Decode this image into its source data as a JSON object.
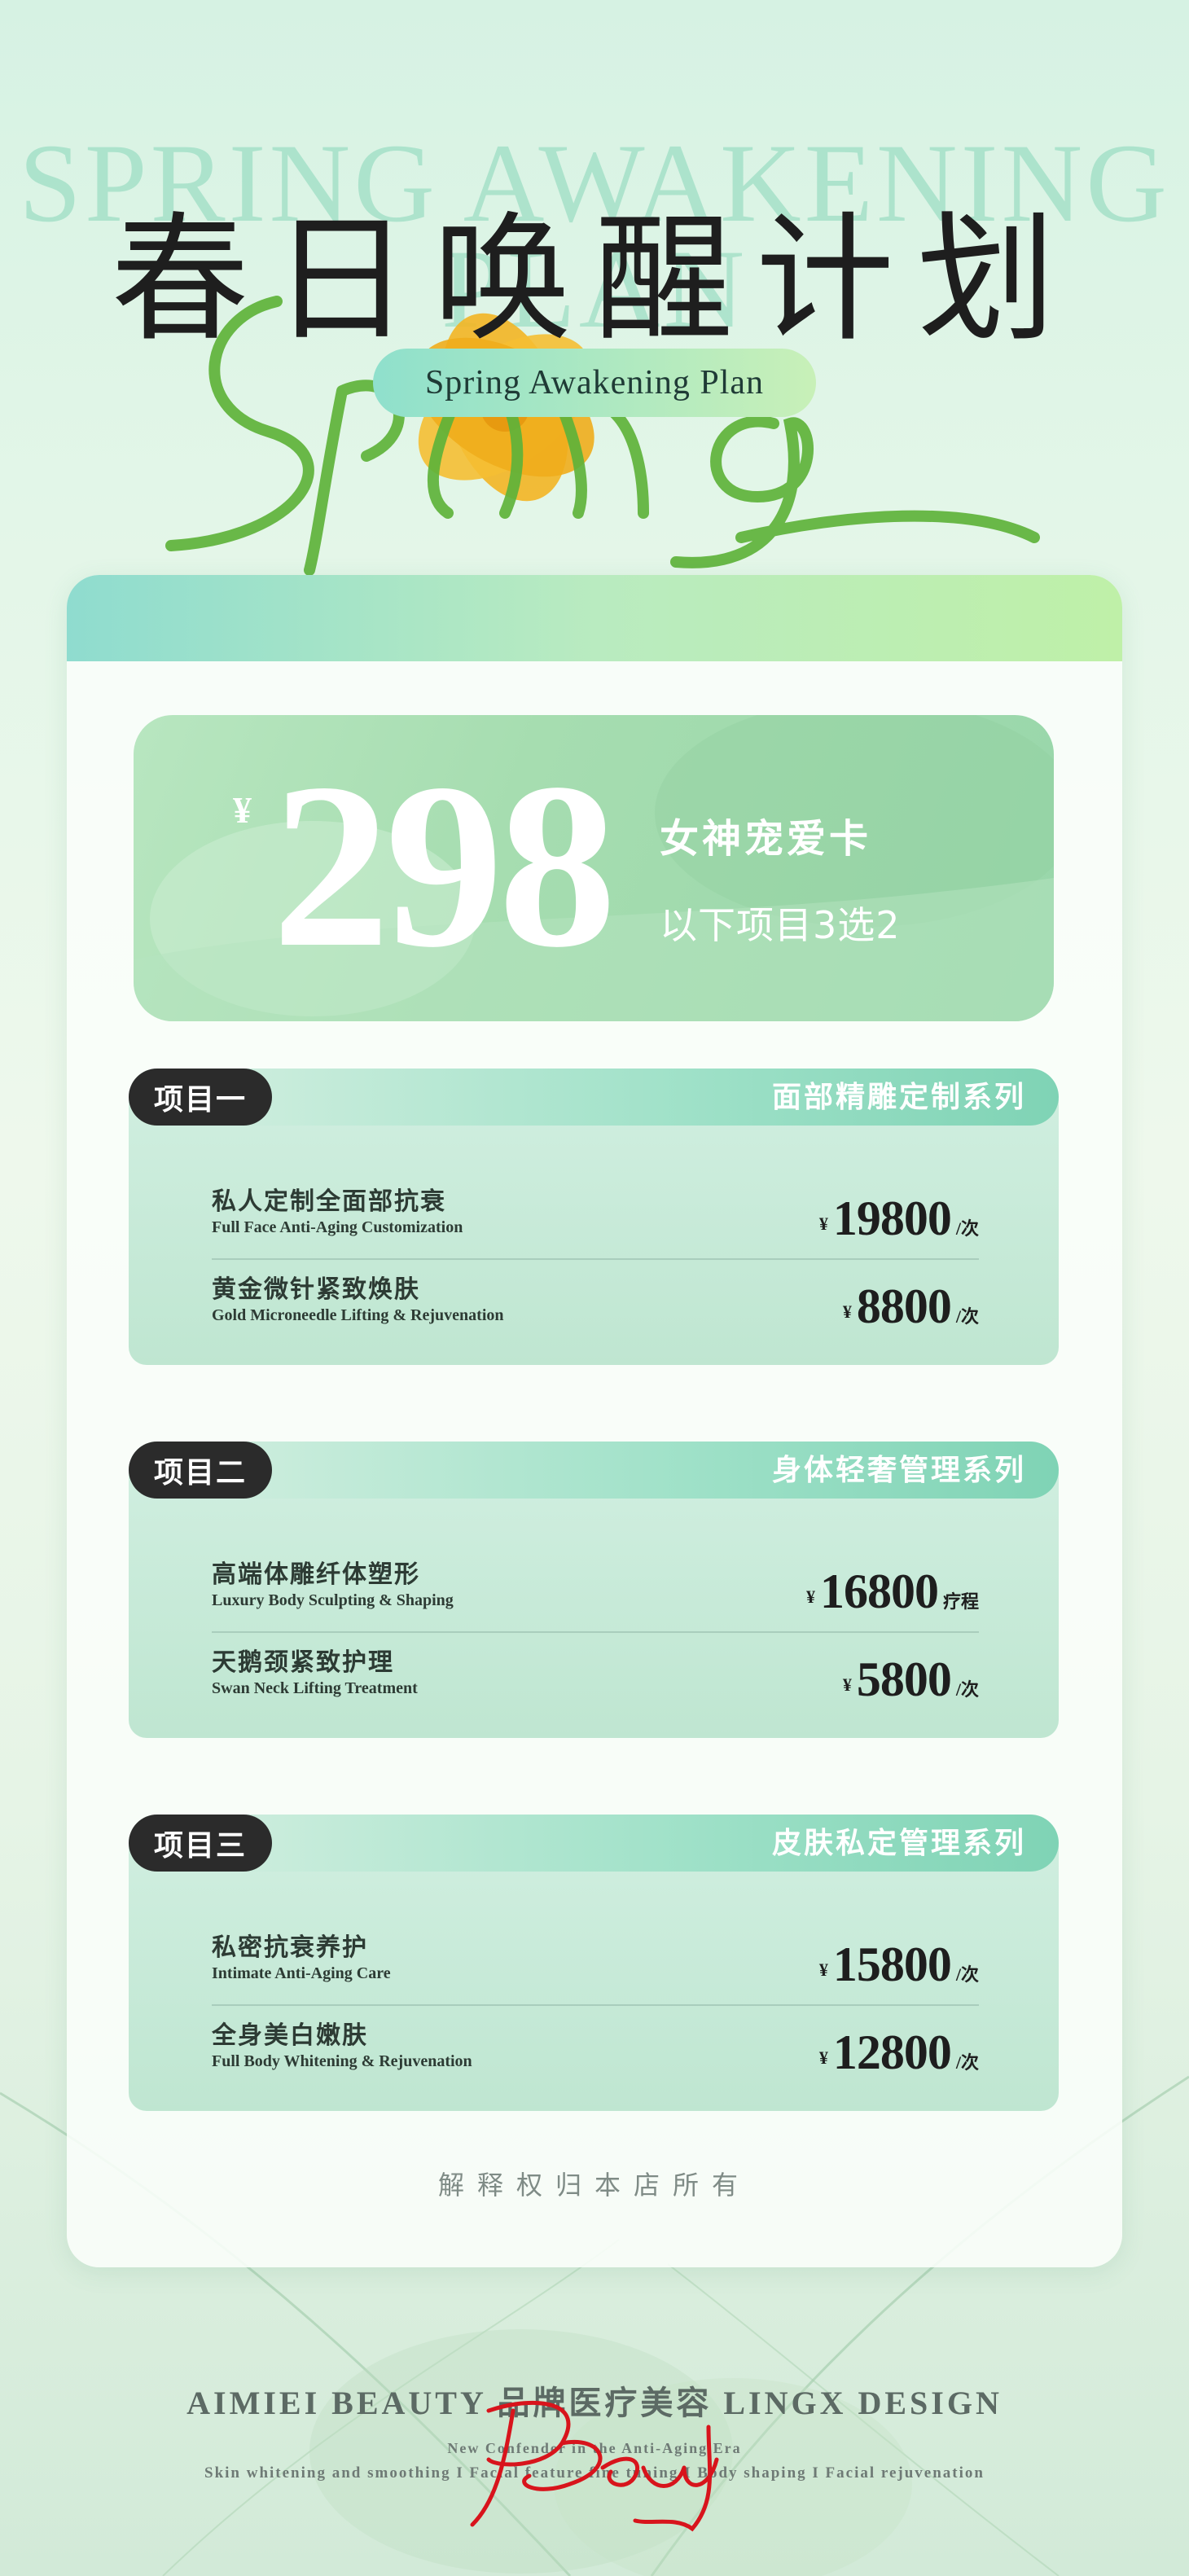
{
  "header": {
    "title_en": "SPRING AWAKENING PLAN",
    "title_cn": "春日唤醒计划",
    "subtitle_pill": "Spring Awakening Plan",
    "script_word": "Spring"
  },
  "offer": {
    "currency": "¥",
    "price": "298",
    "card_name": "女神宠爱卡",
    "rule": "以下项目3选2"
  },
  "sections": [
    {
      "tag": "项目一",
      "name": "面部精雕定制系列",
      "items": [
        {
          "cn": "私人定制全面部抗衰",
          "en": "Full Face Anti-Aging Customization",
          "currency": "¥",
          "price": "19800",
          "unit": "/次"
        },
        {
          "cn": "黄金微针紧致焕肤",
          "en": "Gold Microneedle Lifting & Rejuvenation",
          "currency": "¥",
          "price": "8800",
          "unit": "/次"
        }
      ]
    },
    {
      "tag": "项目二",
      "name": "身体轻奢管理系列",
      "items": [
        {
          "cn": "高端体雕纤体塑形",
          "en": "Luxury Body Sculpting & Shaping",
          "currency": "¥",
          "price": "16800",
          "unit": "疗程"
        },
        {
          "cn": "天鹅颈紧致护理",
          "en": "Swan Neck Lifting Treatment",
          "currency": "¥",
          "price": "5800",
          "unit": "/次"
        }
      ]
    },
    {
      "tag": "项目三",
      "name": "皮肤私定管理系列",
      "items": [
        {
          "cn": "私密抗衰养护",
          "en": "Intimate Anti-Aging Care",
          "currency": "¥",
          "price": "15800",
          "unit": "/次"
        },
        {
          "cn": "全身美白嫩肤",
          "en": "Full Body Whitening & Rejuvenation",
          "currency": "¥",
          "price": "12800",
          "unit": "/次"
        }
      ]
    }
  ],
  "footnote": "解释权归本店所有",
  "footer": {
    "brand_line": "AIMIEI BEAUTY  品牌医疗美容  LINGX DESIGN",
    "tagline": "New Confender in the Anti-Aging Era",
    "services": "Skin whitening and smoothing I Facial feature fine tuning I Body shaping I Facial rejuvenation",
    "signature": "Beauty"
  },
  "colors": {
    "accent_green": "#7fd3b5",
    "dark_tag": "#2b2b2b",
    "flower_yellow": "#f3b524",
    "script_green": "#6cbf3c",
    "signature_red": "#d8141c"
  }
}
